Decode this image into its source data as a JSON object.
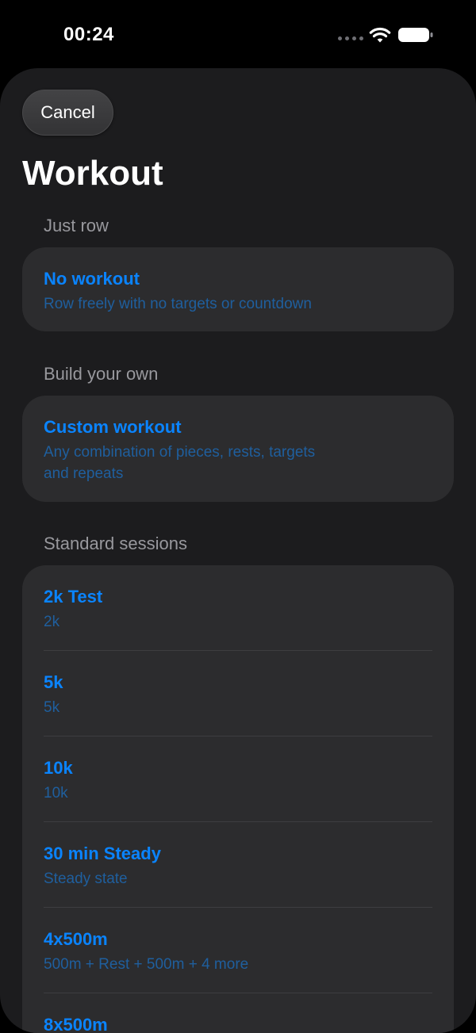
{
  "status_bar": {
    "time": "00:24"
  },
  "header": {
    "cancel_label": "Cancel",
    "title": "Workout"
  },
  "sections": {
    "just_row": {
      "header": "Just row",
      "items": [
        {
          "title": "No workout",
          "subtitle": "Row freely with no targets or countdown"
        }
      ]
    },
    "build_your_own": {
      "header": "Build your own",
      "items": [
        {
          "title": "Custom workout",
          "subtitle_line1": "Any combination of pieces, rests, targets",
          "subtitle_line2": "and repeats"
        }
      ]
    },
    "standard": {
      "header": "Standard sessions",
      "items": [
        {
          "title": "2k Test",
          "subtitle": "2k"
        },
        {
          "title": "5k",
          "subtitle": "5k"
        },
        {
          "title": "10k",
          "subtitle": "10k"
        },
        {
          "title": "30 min Steady",
          "subtitle": "Steady state"
        },
        {
          "title": "4x500m",
          "subtitle": "500m + Rest + 500m + 4 more"
        },
        {
          "title": "8x500m",
          "subtitle": ""
        }
      ]
    }
  },
  "colors": {
    "accent": "#0a84ff",
    "subtitle": "#1f5f9e",
    "background": "#000000",
    "sheet": "#1c1c1e",
    "card": "#2c2c2e",
    "section_header": "#98989d"
  }
}
